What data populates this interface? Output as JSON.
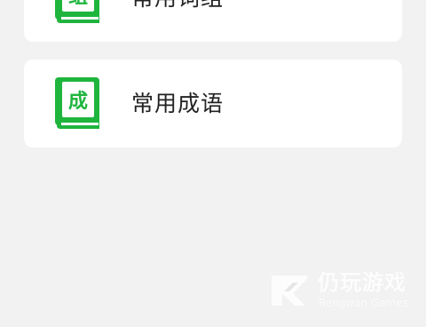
{
  "colors": {
    "background": "#f2f2f2",
    "card": "#ffffff",
    "icon_green": "#1fb53d",
    "text": "#222222",
    "watermark": "#ffffff"
  },
  "list": {
    "items": [
      {
        "label": "常用词组",
        "icon_char": "组",
        "icon": "book-icon"
      },
      {
        "label": "常用成语",
        "icon_char": "成",
        "icon": "book-icon"
      }
    ]
  },
  "watermark": {
    "logo": "rengwan-logo-icon",
    "name_cn": "仍玩游戏",
    "name_en": "Rengwan Games"
  }
}
